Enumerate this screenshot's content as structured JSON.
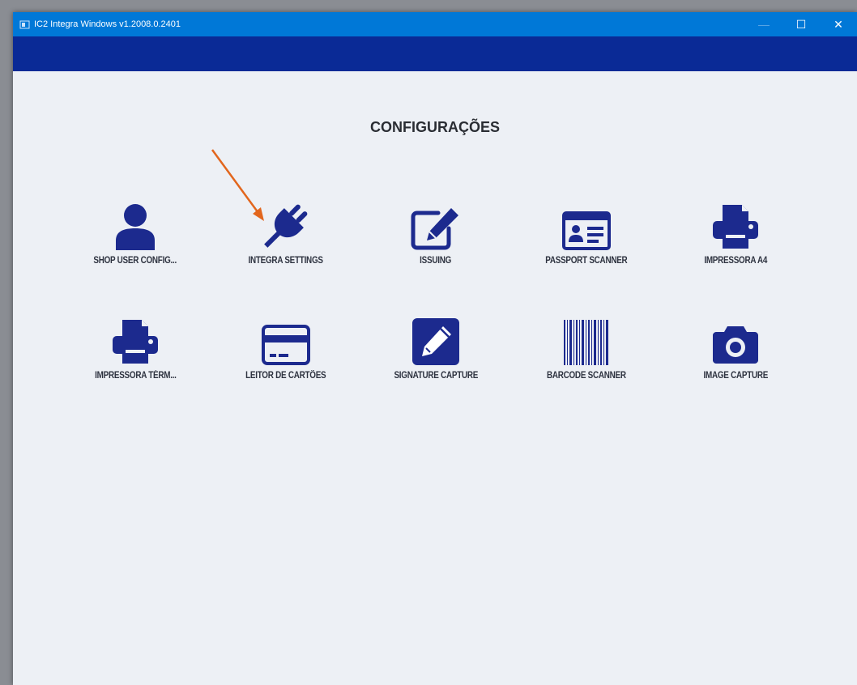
{
  "window": {
    "title": "IC2 Integra Windows  v1.2008.0.2401"
  },
  "controls": {
    "minimize": "—",
    "maximize": "☐",
    "close": "✕"
  },
  "page": {
    "title": "CONFIGURAÇÕES"
  },
  "colors": {
    "titlebar": "#0078d7",
    "header_band": "#0a2a96",
    "icon": "#1c2a8e",
    "background": "#edf0f5",
    "annotation_arrow": "#e2661d"
  },
  "tiles": [
    {
      "label": "SHOP USER CONFIG...",
      "icon": "user-icon"
    },
    {
      "label": "INTEGRA SETTINGS",
      "icon": "plug-icon"
    },
    {
      "label": "ISSUING",
      "icon": "edit-icon"
    },
    {
      "label": "PASSPORT SCANNER",
      "icon": "id-card-icon"
    },
    {
      "label": "IMPRESSORA A4",
      "icon": "printer-icon"
    },
    {
      "label": "IMPRESSORA TÉRM...",
      "icon": "printer-icon"
    },
    {
      "label": "LEITOR DE CARTÕES",
      "icon": "credit-card-icon"
    },
    {
      "label": "SIGNATURE CAPTURE",
      "icon": "pencil-square-icon"
    },
    {
      "label": "BARCODE SCANNER",
      "icon": "barcode-icon"
    },
    {
      "label": "IMAGE CAPTURE",
      "icon": "camera-icon"
    }
  ]
}
